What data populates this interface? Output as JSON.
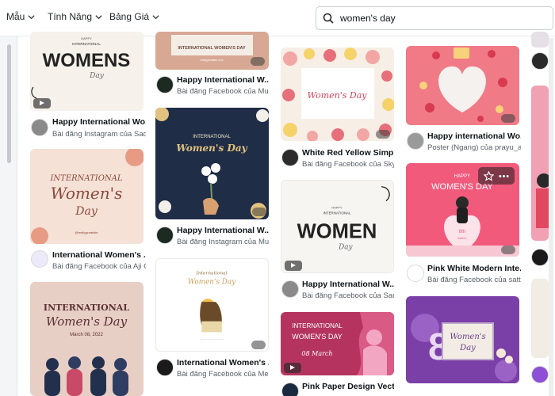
{
  "nav": {
    "mau": "Mẫu",
    "tinh_nang": "Tính Năng",
    "bang_gia": "Bảng Giá"
  },
  "search": {
    "value": "women's day",
    "placeholder": ""
  },
  "colors": {
    "accent": "#7d2ae8",
    "text": "#0d1216",
    "muted": "#5b6168"
  },
  "cards": {
    "c1": {
      "thumb_text": [
        "HAPPY",
        "INTERNATIONAL",
        "WOMENS",
        "Day"
      ],
      "title": "Happy International Wo...",
      "sub": "Bài đăng Instagram của Sada..."
    },
    "c2": {
      "thumb_text": [
        "INTERNATIONAL",
        "Women's",
        "Day",
        "@reallygreatsite"
      ],
      "title": "International Women's ...",
      "sub": "Bài đăng Facebook của Aji G..."
    },
    "c3": {
      "thumb_text": [
        "INTERNATIONAL",
        "Women's Day",
        "March 08, 2022"
      ]
    },
    "c4": {
      "thumb_text": [
        "INTERNATIONAL WOMEN'S DAY",
        "reallygreatsite.com"
      ],
      "title": "Happy International W...",
      "sub": "Bài đăng Facebook của Must ..."
    },
    "c5": {
      "thumb_text": [
        "INTERNATIONAL",
        "Women's Day"
      ],
      "title": "Happy International W...",
      "sub": "Bài đăng Instagram của Mus..."
    },
    "c6": {
      "thumb_text": [
        "International",
        "Women's Day"
      ],
      "title": "International Women's ...",
      "sub": "Bài đăng Facebook của Meet..."
    },
    "c7": {
      "thumb_text": [
        "Women's Day"
      ],
      "title": "White Red Yellow Simpl...",
      "sub": "Bài đăng Facebook của Skyla ..."
    },
    "c8": {
      "thumb_text": [
        "HAPPY",
        "INTERNATIONAL",
        "WOMEN",
        "Day"
      ],
      "title": "Happy International W...",
      "sub": "Bài đăng Facebook của Sadaf..."
    },
    "c9": {
      "thumb_text": [
        "INTERNATIONAL",
        "WOMEN'S DAY",
        "08 March"
      ],
      "title": "Pink Paper Design Vect..."
    },
    "c10": {
      "title": "Happy international Wo...",
      "sub": "Poster (Ngang) của prayu_az..."
    },
    "c11": {
      "thumb_text": [
        "HAPPY",
        "WOMEN'S DAY",
        "8th",
        "March"
      ],
      "title": "Pink White Modern Inte...",
      "sub": "Bài đăng Facebook của sattri"
    },
    "c12": {
      "thumb_text": [
        "Women's",
        "Day"
      ]
    }
  }
}
